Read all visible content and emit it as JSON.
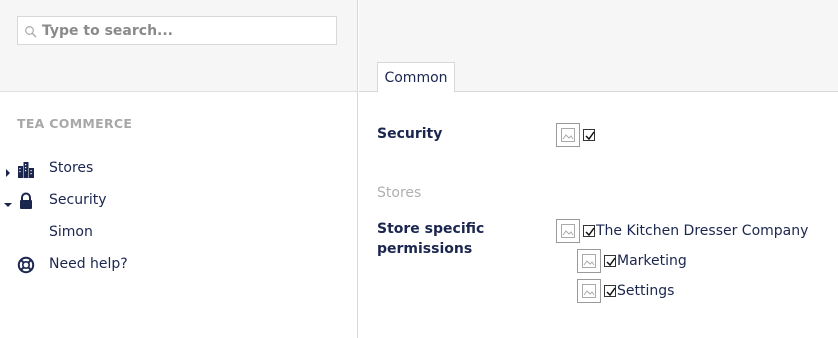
{
  "search": {
    "placeholder": "Type to search..."
  },
  "sidebar": {
    "section_title": "TEA COMMERCE",
    "items": [
      {
        "label": "Stores",
        "icon": "stores-icon",
        "expanded": false
      },
      {
        "label": "Security",
        "icon": "lock-icon",
        "expanded": true
      },
      {
        "label": "Simon",
        "icon": "",
        "expanded": null
      },
      {
        "label": "Need help?",
        "icon": "lifebuoy-icon",
        "expanded": null
      }
    ]
  },
  "tabs": [
    {
      "label": "Common",
      "active": true
    }
  ],
  "properties": {
    "security_label": "Security",
    "security_checked": true,
    "stores_group_label": "Stores",
    "store_permissions_label": "Store specific permissions",
    "store_permissions": [
      {
        "label": "The Kitchen Dresser Company",
        "checked": true,
        "level": 0
      },
      {
        "label": "Marketing",
        "checked": true,
        "level": 1
      },
      {
        "label": "Settings",
        "checked": true,
        "level": 1
      }
    ]
  },
  "colors": {
    "text": "#1b264f",
    "muted": "#a8a8a8",
    "panel_bg": "#f6f6f6",
    "border": "#d8d7d9"
  }
}
